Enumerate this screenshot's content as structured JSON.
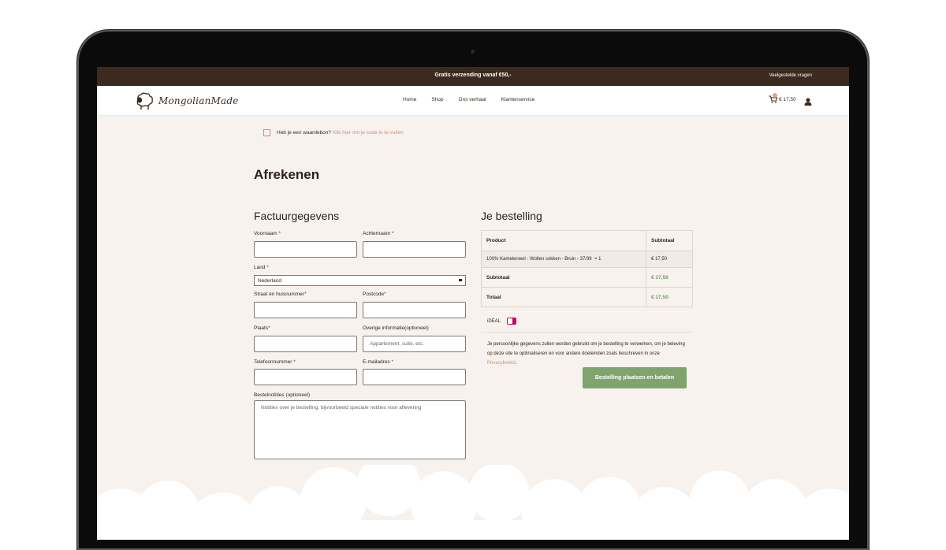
{
  "topbar": {
    "promo": "Gratis verzending vanaf €50,-",
    "faq": "Veelgestelde vragen"
  },
  "header": {
    "logo_text": "MongolianMade",
    "nav": [
      "Home",
      "Shop",
      "Ons verhaal",
      "Klantenservice"
    ],
    "cart_total": "€ 17,50"
  },
  "coupon": {
    "text": "Heb je een waardebon?",
    "link": "Klik hier om je code in te vullen"
  },
  "page_title": "Afrekenen",
  "billing": {
    "heading": "Factuurgegevens",
    "first_name_label": "Voornaam",
    "last_name_label": "Achternaam",
    "country_label": "Land",
    "country_value": "Nederland",
    "street_label": "Straat en huisnummer",
    "postcode_label": "Postcode",
    "city_label": "Plaats",
    "other_label": "Overige informatie(optioneel)",
    "other_placeholder": "Appartement, suite, etc.",
    "phone_label": "Telefoonnummer",
    "email_label": "E-mailadres",
    "notes_label": "Bestelnotities (optioneel)",
    "notes_placeholder": "Notities over je bestelling, bijvoorbeeld speciale notities voor aflevering",
    "required_mark": "*"
  },
  "order": {
    "heading": "Je bestelling",
    "col_product": "Product",
    "col_subtotal": "Subtotaal",
    "item_name": "100% Kamelenwol - Wollen sokken - Bruin - 37/39",
    "item_qty": "× 1",
    "item_price": "€ 17,50",
    "subtotal_label": "Subtotaal",
    "subtotal_value": "€ 17,50",
    "total_label": "Totaal",
    "total_value": "€ 17,50"
  },
  "payment": {
    "method": "iDEAL"
  },
  "privacy": {
    "text": "Je persoonlijke gegevens zullen worden gebruikt om je bestelling te verwerken, om je beleving op deze site te optimaliseren en voor andere doeleinden zoals beschreven in onze",
    "link": "Privacybeleid",
    "end": "."
  },
  "place_order_label": "Bestelling plaatsen en betalen",
  "colors": {
    "topbar": "#3b2a1d",
    "accent": "#d98a73",
    "button": "#7fa46e",
    "background": "#f7f2ee"
  }
}
